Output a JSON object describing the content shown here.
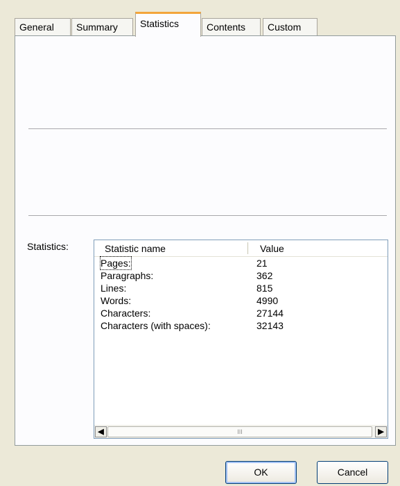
{
  "tabs": [
    "General",
    "Summary",
    "Statistics",
    "Contents",
    "Custom"
  ],
  "active_tab": "Statistics",
  "statistics_label": "Statistics:",
  "list": {
    "columns": [
      "Statistic name",
      "Value"
    ],
    "rows": [
      {
        "name": "Pages:",
        "value": "21"
      },
      {
        "name": "Paragraphs:",
        "value": "362"
      },
      {
        "name": "Lines:",
        "value": "815"
      },
      {
        "name": "Words:",
        "value": "4990"
      },
      {
        "name": "Characters:",
        "value": "27144"
      },
      {
        "name": "Characters (with spaces):",
        "value": "32143"
      }
    ],
    "scroll_thumb_grip": "III"
  },
  "buttons": {
    "ok": "OK",
    "cancel": "Cancel"
  },
  "icons": {
    "scroll_left": "scroll-left-arrow-icon",
    "scroll_right": "scroll-right-arrow-icon"
  },
  "colors": {
    "active_tab_accent": "#f3a53b",
    "dialog_bg": "#ece9d8",
    "panel_bg": "#fcfcfe"
  }
}
